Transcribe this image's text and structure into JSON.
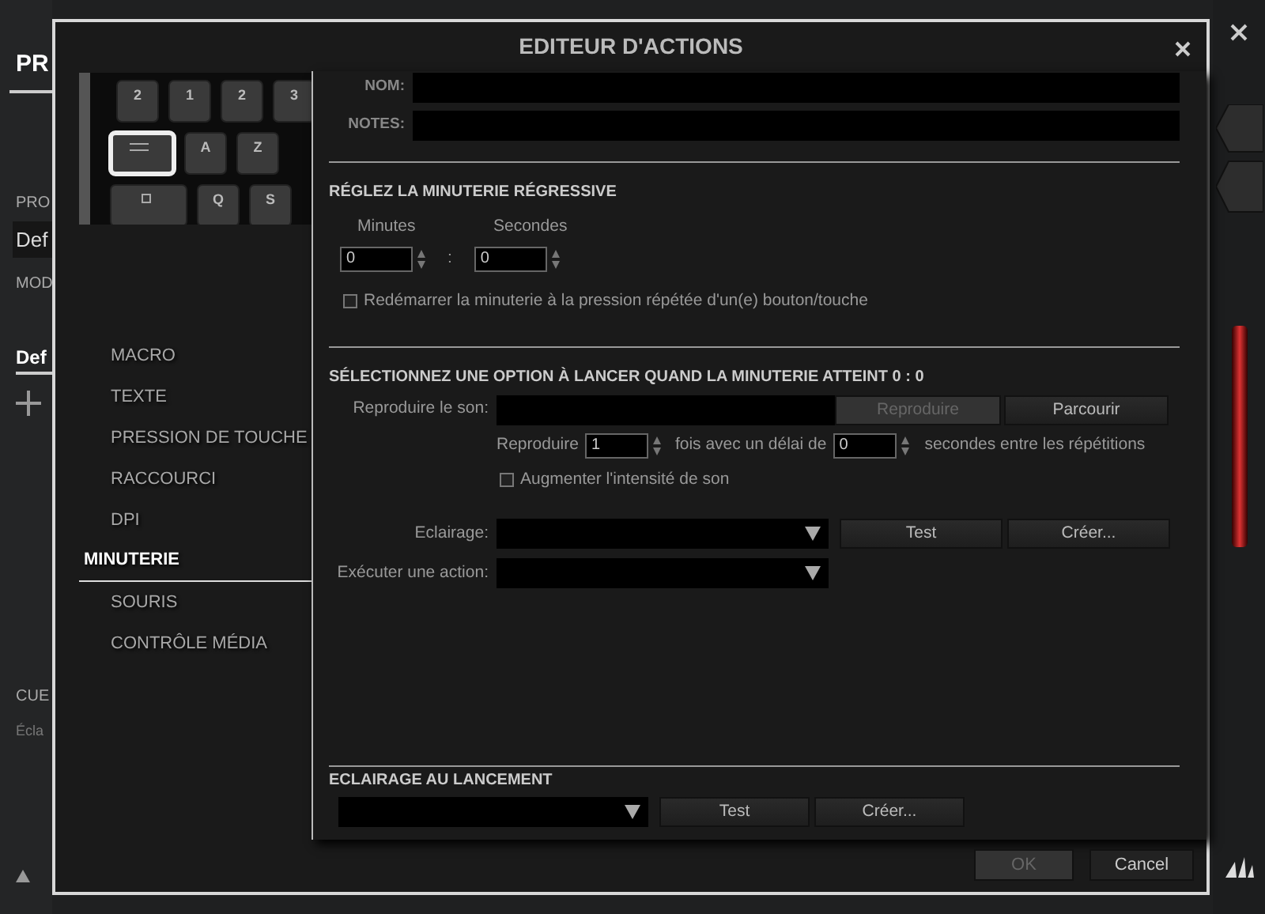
{
  "background_app": {
    "tab": "PR",
    "profile_label": "PRO",
    "profile_value": "Def",
    "mode_label": "MOD",
    "mode_tab": "Def",
    "cue_label": "CUE",
    "cue_value": "Écla"
  },
  "dialog": {
    "title": "EDITEUR D'ACTIONS",
    "keyboard": [
      [
        {
          "label": "2",
          "selected": false
        },
        {
          "label": "1",
          "selected": false
        },
        {
          "label": "2",
          "selected": false
        },
        {
          "label": "3",
          "selected": false
        }
      ],
      [
        {
          "kind": "tab",
          "selected": true
        },
        {
          "label": "A",
          "selected": false
        },
        {
          "label": "Z",
          "selected": false
        }
      ],
      [
        {
          "kind": "caps",
          "selected": false
        },
        {
          "label": "Q",
          "selected": false
        },
        {
          "label": "S",
          "selected": false
        }
      ]
    ],
    "menu": [
      {
        "label": "MACRO",
        "selected": false
      },
      {
        "label": "TEXTE",
        "selected": false
      },
      {
        "label": "PRESSION DE TOUCHE",
        "selected": false
      },
      {
        "label": "RACCOURCI",
        "selected": false
      },
      {
        "label": "DPI",
        "selected": false
      },
      {
        "label": "MINUTERIE",
        "selected": true
      },
      {
        "label": "SOURIS",
        "selected": false
      },
      {
        "label": "CONTRÔLE MÉDIA",
        "selected": false
      }
    ],
    "fields": [
      {
        "label": "NOM:"
      },
      {
        "label": "NOTES:"
      }
    ],
    "timer": {
      "heading": "RÉGLEZ LA MINUTERIE RÉGRESSIVE",
      "minutes_label": "Minutes",
      "minutes": "0",
      "separator": ":",
      "seconds_label": "Secondes",
      "seconds": "0",
      "restart": {
        "label": "Redémarrer la minuterie à la pression répétée d'un(e) bouton/touche",
        "checked": false
      }
    },
    "on_end": {
      "heading": "SÉLECTIONNEZ UNE OPTION À LANCER QUAND LA MINUTERIE ATTEINT 0 : 0",
      "sound_label": "Reproduire le son:",
      "sound_buttons": [
        {
          "label": "Reproduire",
          "disabled": true
        },
        {
          "label": "Parcourir",
          "disabled": false
        }
      ],
      "repeat_label": "Reproduire",
      "repeat_count": "1",
      "delay_label": "fois avec un délai de",
      "delay": "0",
      "delay_suffix": "secondes entre les répétitions",
      "increase": {
        "label": "Augmenter l'intensité de son",
        "checked": false
      },
      "lighting_label": "Eclairage:",
      "lighting_buttons": [
        {
          "label": "Test",
          "disabled": false
        },
        {
          "label": "Créer...",
          "disabled": false
        }
      ],
      "action_label": "Exécuter une action:"
    },
    "launch_lighting": {
      "heading": "ECLAIRAGE AU LANCEMENT",
      "buttons": [
        {
          "label": "Test",
          "disabled": false
        },
        {
          "label": "Créer...",
          "disabled": false
        }
      ]
    },
    "footer_buttons": [
      {
        "label": "OK",
        "disabled": true
      },
      {
        "label": "Cancel",
        "disabled": false
      }
    ]
  }
}
